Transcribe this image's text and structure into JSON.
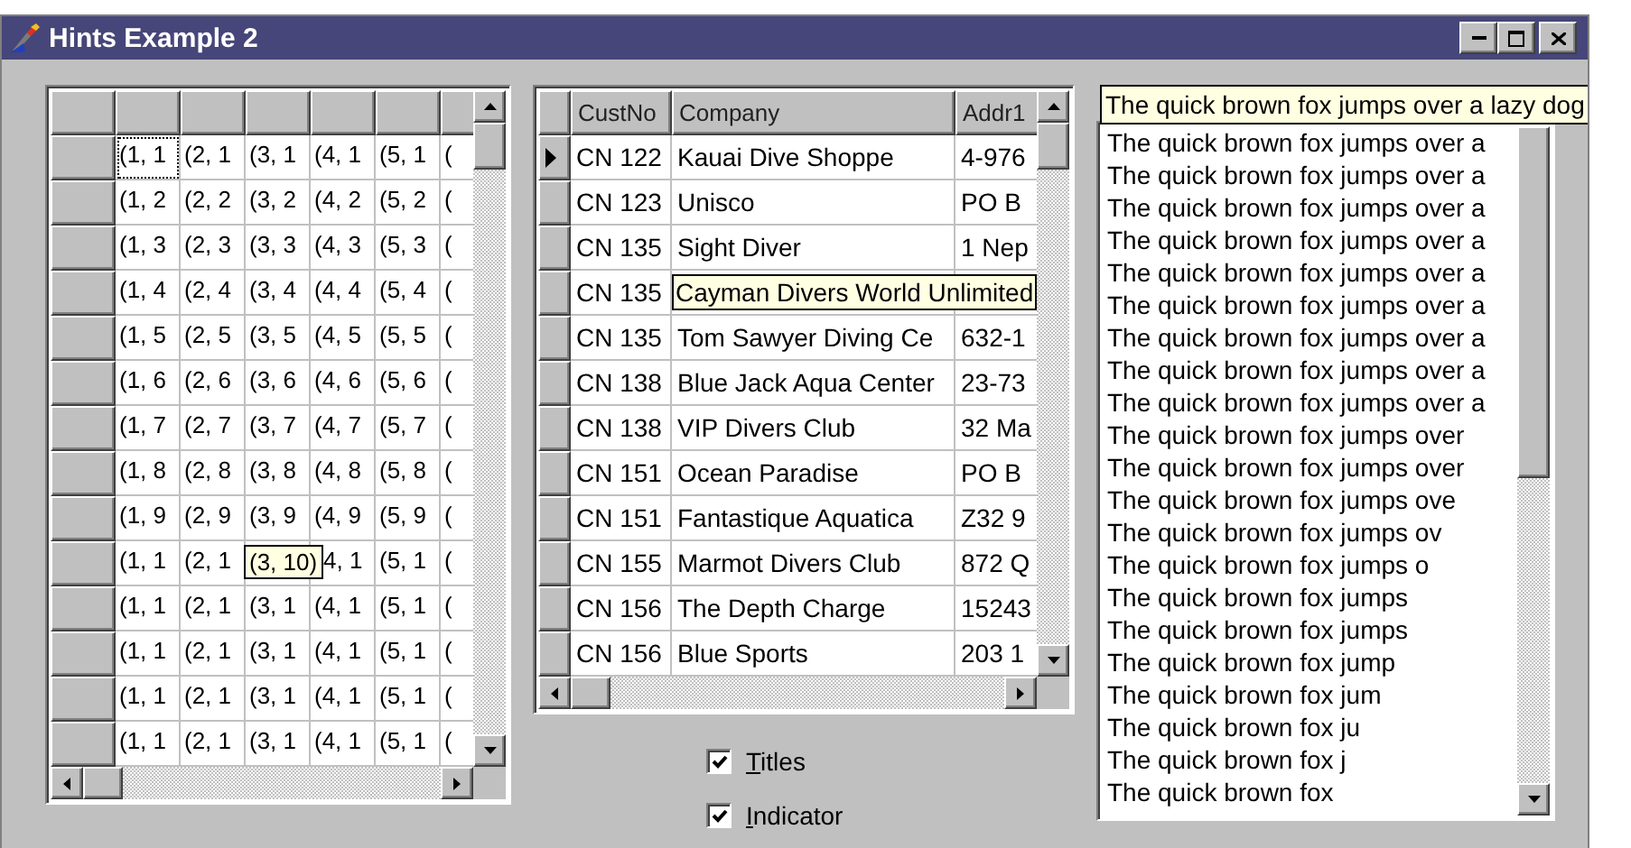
{
  "window": {
    "title": "Hints Example 2"
  },
  "string_grid": {
    "rows": [
      {
        "cells": [
          {
            "text": "(1, 1",
            "focused": true
          },
          {
            "text": "(2, 1",
            "focused": false
          },
          {
            "text": "(3, 1",
            "focused": false
          },
          {
            "text": "(4, 1",
            "focused": false
          },
          {
            "text": "(5, 1",
            "focused": false
          },
          {
            "text": "(",
            "focused": false
          }
        ]
      },
      {
        "cells": [
          {
            "text": "(1, 2",
            "focused": false
          },
          {
            "text": "(2, 2",
            "focused": false
          },
          {
            "text": "(3, 2",
            "focused": false
          },
          {
            "text": "(4, 2",
            "focused": false
          },
          {
            "text": "(5, 2",
            "focused": false
          },
          {
            "text": "(",
            "focused": false
          }
        ]
      },
      {
        "cells": [
          {
            "text": "(1, 3",
            "focused": false
          },
          {
            "text": "(2, 3",
            "focused": false
          },
          {
            "text": "(3, 3",
            "focused": false
          },
          {
            "text": "(4, 3",
            "focused": false
          },
          {
            "text": "(5, 3",
            "focused": false
          },
          {
            "text": "(",
            "focused": false
          }
        ]
      },
      {
        "cells": [
          {
            "text": "(1, 4",
            "focused": false
          },
          {
            "text": "(2, 4",
            "focused": false
          },
          {
            "text": "(3, 4",
            "focused": false
          },
          {
            "text": "(4, 4",
            "focused": false
          },
          {
            "text": "(5, 4",
            "focused": false
          },
          {
            "text": "(",
            "focused": false
          }
        ]
      },
      {
        "cells": [
          {
            "text": "(1, 5",
            "focused": false
          },
          {
            "text": "(2, 5",
            "focused": false
          },
          {
            "text": "(3, 5",
            "focused": false
          },
          {
            "text": "(4, 5",
            "focused": false
          },
          {
            "text": "(5, 5",
            "focused": false
          },
          {
            "text": "(",
            "focused": false
          }
        ]
      },
      {
        "cells": [
          {
            "text": "(1, 6",
            "focused": false
          },
          {
            "text": "(2, 6",
            "focused": false
          },
          {
            "text": "(3, 6",
            "focused": false
          },
          {
            "text": "(4, 6",
            "focused": false
          },
          {
            "text": "(5, 6",
            "focused": false
          },
          {
            "text": "(",
            "focused": false
          }
        ]
      },
      {
        "cells": [
          {
            "text": "(1, 7",
            "focused": false
          },
          {
            "text": "(2, 7",
            "focused": false
          },
          {
            "text": "(3, 7",
            "focused": false
          },
          {
            "text": "(4, 7",
            "focused": false
          },
          {
            "text": "(5, 7",
            "focused": false
          },
          {
            "text": "(",
            "focused": false
          }
        ]
      },
      {
        "cells": [
          {
            "text": "(1, 8",
            "focused": false
          },
          {
            "text": "(2, 8",
            "focused": false
          },
          {
            "text": "(3, 8",
            "focused": false
          },
          {
            "text": "(4, 8",
            "focused": false
          },
          {
            "text": "(5, 8",
            "focused": false
          },
          {
            "text": "(",
            "focused": false
          }
        ]
      },
      {
        "cells": [
          {
            "text": "(1, 9",
            "focused": false
          },
          {
            "text": "(2, 9",
            "focused": false
          },
          {
            "text": "(3, 9",
            "focused": false
          },
          {
            "text": "(4, 9",
            "focused": false
          },
          {
            "text": "(5, 9",
            "focused": false
          },
          {
            "text": "(",
            "focused": false
          }
        ]
      },
      {
        "cells": [
          {
            "text": "(1, 1",
            "focused": false
          },
          {
            "text": "(2, 1",
            "focused": false
          },
          {
            "hint": "(3, 10)",
            "focused": false
          },
          {
            "text": "4, 1",
            "focused": false
          },
          {
            "text": "(5, 1",
            "focused": false
          },
          {
            "text": "(",
            "focused": false
          }
        ]
      },
      {
        "cells": [
          {
            "text": "(1, 1",
            "focused": false
          },
          {
            "text": "(2, 1",
            "focused": false
          },
          {
            "text": "(3, 1",
            "focused": false
          },
          {
            "text": "(4, 1",
            "focused": false
          },
          {
            "text": "(5, 1",
            "focused": false
          },
          {
            "text": "(",
            "focused": false
          }
        ]
      },
      {
        "cells": [
          {
            "text": "(1, 1",
            "focused": false
          },
          {
            "text": "(2, 1",
            "focused": false
          },
          {
            "text": "(3, 1",
            "focused": false
          },
          {
            "text": "(4, 1",
            "focused": false
          },
          {
            "text": "(5, 1",
            "focused": false
          },
          {
            "text": "(",
            "focused": false
          }
        ]
      },
      {
        "cells": [
          {
            "text": "(1, 1",
            "focused": false
          },
          {
            "text": "(2, 1",
            "focused": false
          },
          {
            "text": "(3, 1",
            "focused": false
          },
          {
            "text": "(4, 1",
            "focused": false
          },
          {
            "text": "(5, 1",
            "focused": false
          },
          {
            "text": "(",
            "focused": false
          }
        ]
      },
      {
        "cells": [
          {
            "text": "(1, 1",
            "focused": false
          },
          {
            "text": "(2, 1",
            "focused": false
          },
          {
            "text": "(3, 1",
            "focused": false
          },
          {
            "text": "(4, 1",
            "focused": false
          },
          {
            "text": "(5, 1",
            "focused": false
          },
          {
            "text": "(",
            "focused": false
          }
        ]
      }
    ]
  },
  "db_grid": {
    "columns": [
      "CustNo",
      "Company",
      "Addr1"
    ],
    "rows": [
      {
        "current": true,
        "cells": [
          "CN 122",
          "Kauai Dive Shoppe",
          "4-976"
        ]
      },
      {
        "current": false,
        "cells": [
          "CN 123",
          "Unisco",
          "PO B"
        ]
      },
      {
        "current": false,
        "cells": [
          "CN 135",
          "Sight Diver",
          "1 Nep"
        ]
      },
      {
        "current": false,
        "cells": [
          "CN 135"
        ],
        "hint": "Cayman Divers World Unlimited"
      },
      {
        "current": false,
        "cells": [
          "CN 135",
          "Tom Sawyer Diving Ce",
          "632-1"
        ]
      },
      {
        "current": false,
        "cells": [
          "CN 138",
          "Blue Jack Aqua Center",
          "23-73"
        ]
      },
      {
        "current": false,
        "cells": [
          "CN 138",
          "VIP Divers Club",
          "32 Ma"
        ]
      },
      {
        "current": false,
        "cells": [
          "CN 151",
          "Ocean Paradise",
          "PO B"
        ]
      },
      {
        "current": false,
        "cells": [
          "CN 151",
          "Fantastique Aquatica",
          "Z32 9"
        ]
      },
      {
        "current": false,
        "cells": [
          "CN 155",
          "Marmot Divers Club",
          "872 Q"
        ]
      },
      {
        "current": false,
        "cells": [
          "CN 156",
          "The Depth Charge",
          "15243"
        ]
      },
      {
        "current": false,
        "cells": [
          "CN 156",
          "Blue Sports",
          "203 1"
        ]
      }
    ]
  },
  "checkboxes": [
    {
      "label": "Titles",
      "checked": true
    },
    {
      "label": "Indicator",
      "checked": true
    }
  ],
  "listbox": {
    "hint": "The quick brown fox jumps over a lazy dog",
    "items": [
      "The quick brown fox jumps over a",
      "The quick brown fox jumps over a",
      "The quick brown fox jumps over a",
      "The quick brown fox jumps over a",
      "The quick brown fox jumps over a",
      "The quick brown fox jumps over a",
      "The quick brown fox jumps over a",
      "The quick brown fox jumps over a",
      "The quick brown fox jumps over a",
      "The quick brown fox jumps over",
      "The quick brown fox jumps over",
      "The quick brown fox jumps ove",
      "The quick brown fox jumps ov",
      "The quick brown fox jumps o",
      "The quick brown fox jumps",
      "The quick brown fox jumps",
      "The quick brown fox jump",
      "The quick brown fox jum",
      "The quick brown fox ju",
      "The quick brown fox j",
      "The quick brown fox"
    ]
  }
}
